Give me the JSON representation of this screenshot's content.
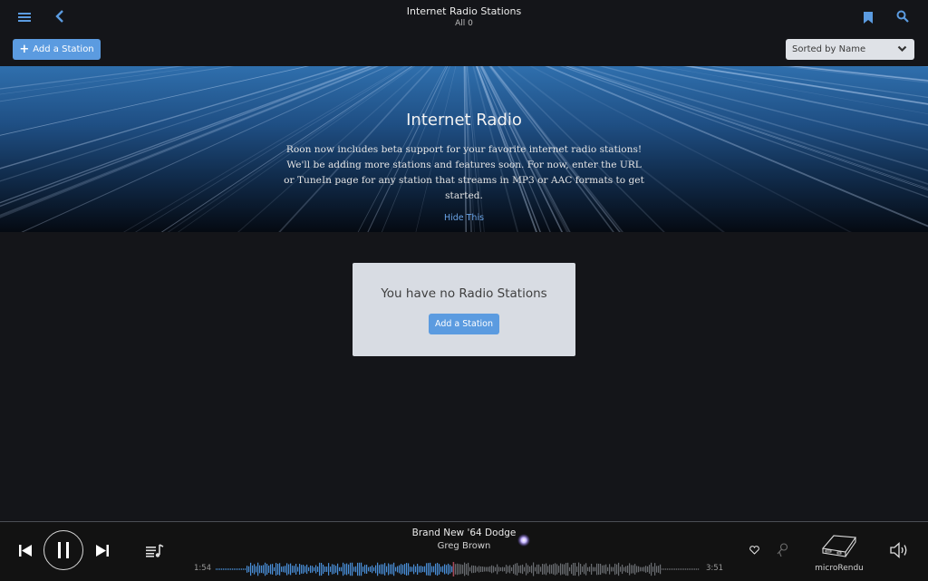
{
  "header": {
    "title": "Internet Radio Stations",
    "subtitle": "All 0",
    "menu_icon": "hamburger-menu-icon",
    "back_icon": "chevron-left-icon",
    "bookmark_icon": "bookmark-icon",
    "search_icon": "search-icon",
    "accent_color": "#5b9be0"
  },
  "toolbar": {
    "add_label": "Add a Station",
    "add_icon": "plus-icon",
    "sort_value": "Sorted by Name"
  },
  "banner": {
    "title": "Internet Radio",
    "text": "Roon now includes beta support for your favorite internet radio stations! We'll be adding more stations and features soon. For now, enter the URL or TuneIn page for any station that streams in MP3 or AAC formats to get started.",
    "hide_label": "Hide This"
  },
  "empty_state": {
    "message": "You have no Radio Stations",
    "button_label": "Add a Station"
  },
  "player": {
    "track_title": "Brand New '64 Dodge",
    "artist": "Greg Brown",
    "elapsed": "1:54",
    "duration": "3:51",
    "progress_fraction": 0.49,
    "zone_name": "microRendu",
    "icons": [
      "previous-icon",
      "pause-icon",
      "next-icon",
      "queue-icon",
      "heart-icon",
      "radio-pin-icon",
      "device-icon",
      "volume-icon",
      "sparkle-icon"
    ]
  }
}
